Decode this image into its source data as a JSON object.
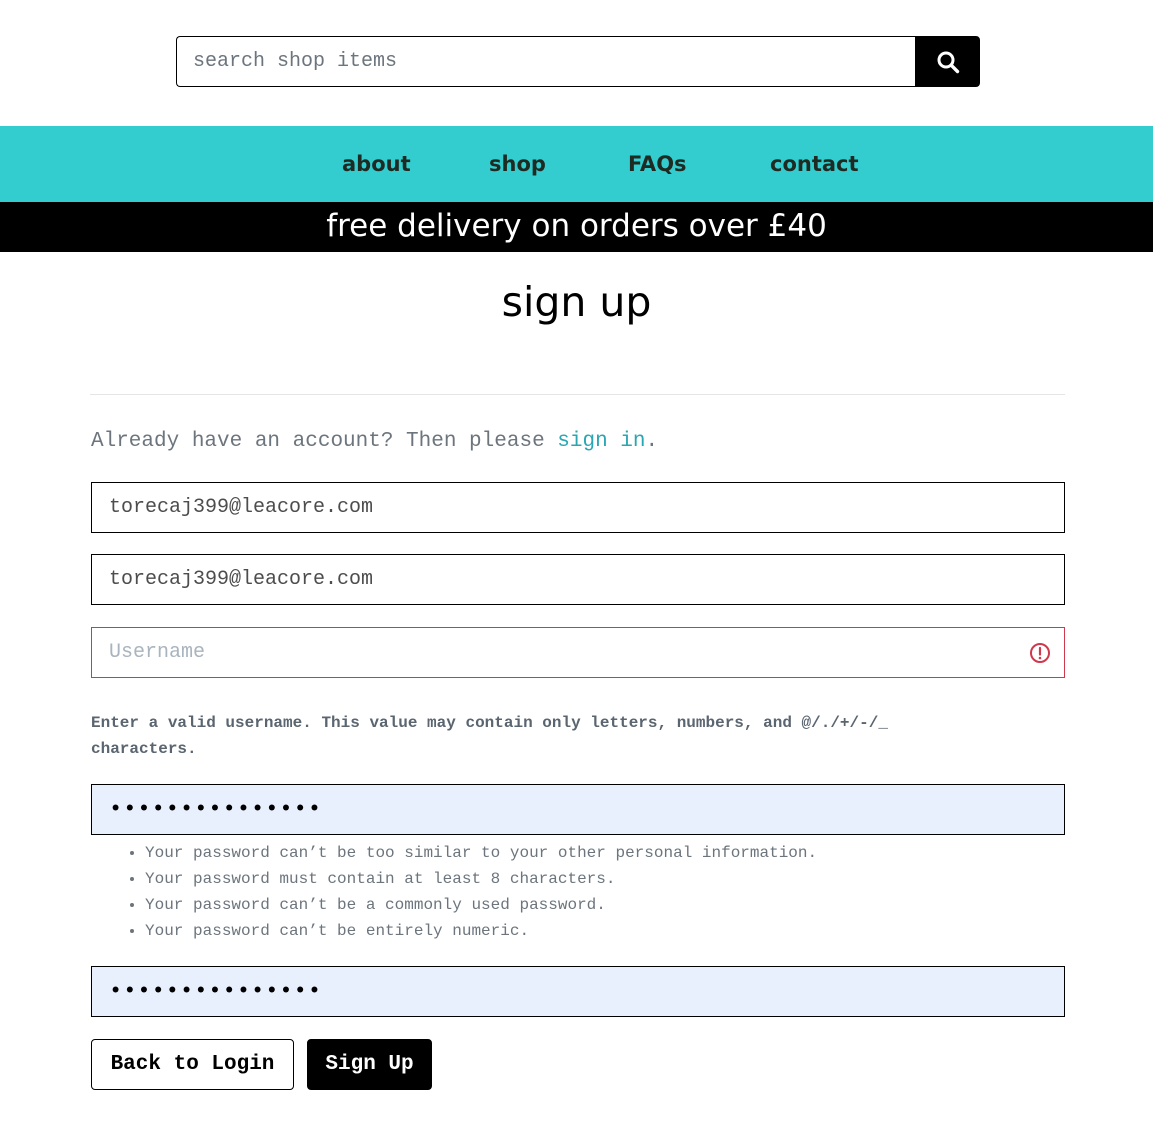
{
  "search": {
    "placeholder": "search shop items",
    "icon": "search-icon"
  },
  "nav": {
    "background": "#33cccf",
    "items": [
      {
        "label": "about"
      },
      {
        "label": "shop"
      },
      {
        "label": "FAQs"
      },
      {
        "label": "contact"
      }
    ]
  },
  "banner": {
    "text": "free delivery on orders over £40"
  },
  "page": {
    "title": "sign up"
  },
  "signup": {
    "already_text": "Already have an account? Then please ",
    "sign_in_link": "sign in",
    "already_suffix": ".",
    "email_value": "torecaj399@leacore.com",
    "email_confirm_value": "torecaj399@leacore.com",
    "username_placeholder": "Username",
    "username_error": "Enter a valid username. This value may contain only letters, numbers, and @/./+/-/_ characters.",
    "password_value": "•••••••••••••••",
    "password_help": [
      "Your password can’t be too similar to your other personal information.",
      "Your password must contain at least 8 characters.",
      "Your password can’t be a commonly used password.",
      "Your password can’t be entirely numeric."
    ],
    "password_confirm_value": "•••••••••••••••",
    "back_label": "Back to Login",
    "submit_label": "Sign Up"
  },
  "colors": {
    "accent": "#33cccf",
    "link": "#2aa6b2",
    "error": "#d0384d",
    "autofill": "#e8f0fe"
  }
}
